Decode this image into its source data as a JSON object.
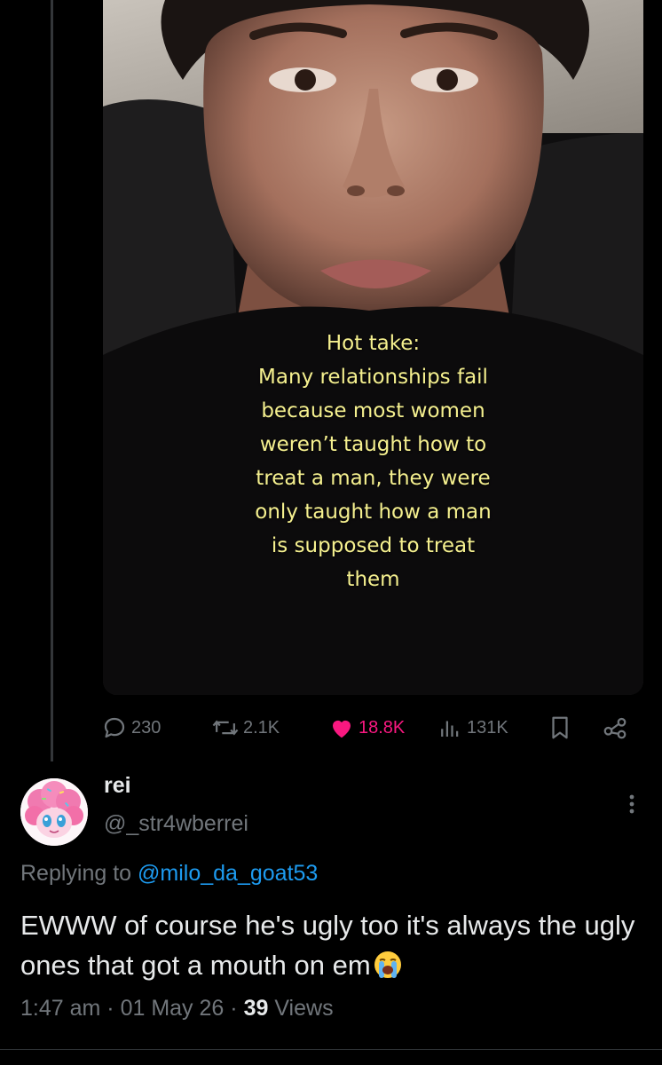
{
  "video": {
    "overlay_text": "Hot take:\nMany relationships fail\nbecause most women\nweren’t taught how to\ntreat a man, they were\nonly taught how a man\nis supposed to treat\nthem"
  },
  "actions": {
    "replies": "230",
    "reposts": "2.1K",
    "likes": "18.8K",
    "views": "131K"
  },
  "reply_tweet": {
    "display_name": "rei",
    "handle": "@_str4wberrei",
    "replying_label": "Replying to",
    "replying_to": "@milo_da_goat53",
    "text": "EWWW of course he's ugly too it's always the ugly ones that got a mouth on em",
    "emoji": "loudly-crying-face",
    "time": "1:47 am",
    "separator": "·",
    "date": "01 May 26",
    "views_count": "39",
    "views_label": "Views"
  },
  "colors": {
    "background": "#000000",
    "text_primary": "#e7e9ea",
    "text_secondary": "#71767b",
    "like_pink": "#f91880",
    "link_blue": "#1d9bf0",
    "caption_yellow": "#f5f08f"
  }
}
